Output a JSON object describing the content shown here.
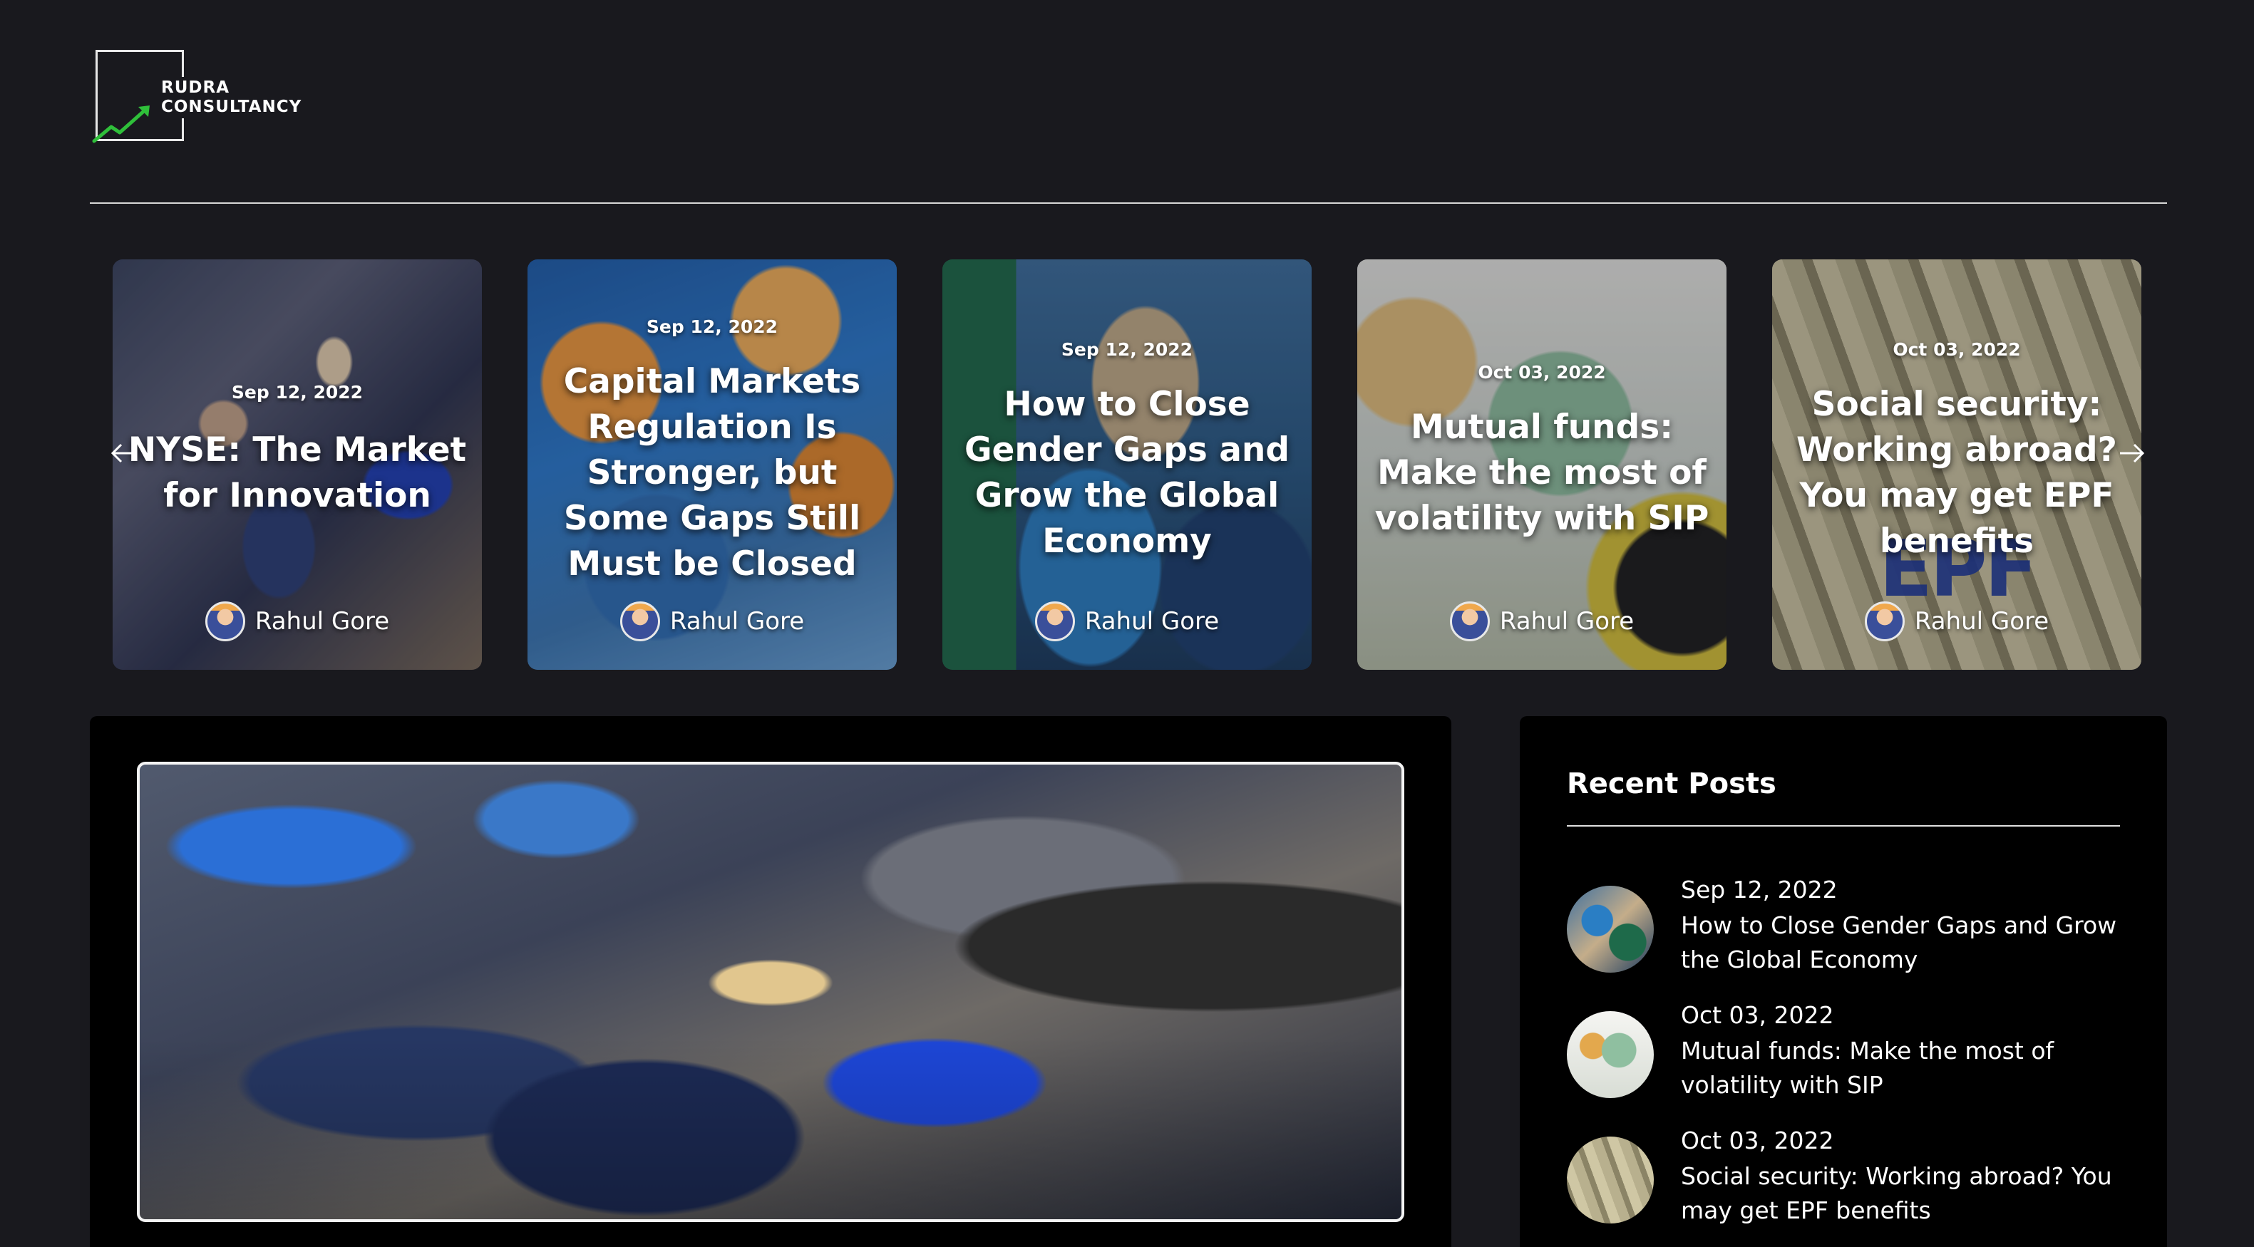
{
  "header": {
    "logo": {
      "line1": "RUDRA",
      "line2": "CONSULTANCY"
    }
  },
  "carousel": {
    "cards": [
      {
        "date": "Sep 12, 2022",
        "title": "NYSE: The Market for Innovation",
        "author": "Rahul Gore"
      },
      {
        "date": "Sep 12, 2022",
        "title": "Capital Markets Regulation Is Stronger, but Some Gaps Still Must be Closed",
        "author": "Rahul Gore"
      },
      {
        "date": "Sep 12, 2022",
        "title": "How to Close Gender Gaps and Grow the Global Economy",
        "author": "Rahul Gore"
      },
      {
        "date": "Oct 03, 2022",
        "title": "Mutual funds: Make the most of volatility with SIP",
        "author": "Rahul Gore"
      },
      {
        "date": "Oct 03, 2022",
        "title": "Social security: Working abroad? You may get EPF benefits",
        "author": "Rahul Gore"
      }
    ],
    "epf_mark": "EPF"
  },
  "sidebar": {
    "title": "Recent Posts",
    "posts": [
      {
        "date": "Sep 12, 2022",
        "title": "How to Close Gender Gaps and Grow the Global Economy"
      },
      {
        "date": "Oct 03, 2022",
        "title": "Mutual funds: Make the most of volatility with SIP"
      },
      {
        "date": "Oct 03, 2022",
        "title": "Social security: Working abroad? You may get EPF benefits"
      }
    ]
  },
  "icons": {
    "logo": "trend-up-arrow-icon",
    "prev": "arrow-left-icon",
    "next": "arrow-right-icon"
  },
  "colors": {
    "background": "#19191e",
    "panel": "#000000",
    "logo_accent": "#2fbf3a",
    "text": "#ffffff"
  }
}
